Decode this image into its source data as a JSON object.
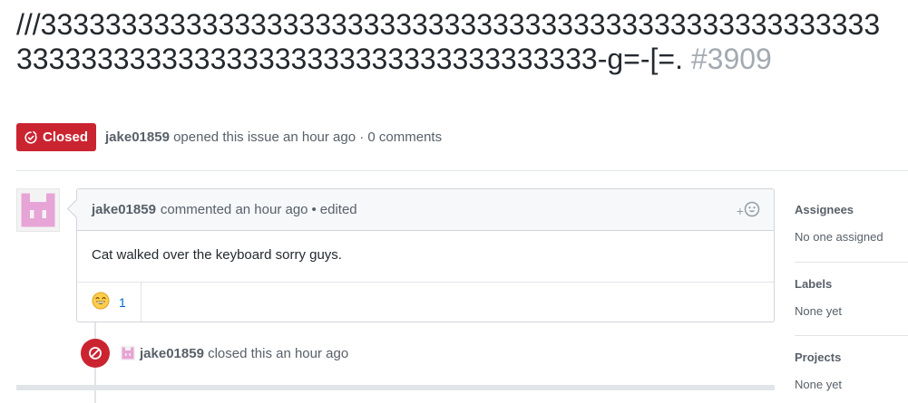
{
  "issue": {
    "title": "///3333333333333333333333333333333333333333333333333333333333333333333333333333333333333333-g=-[=.",
    "number": "#3909",
    "state_label": "Closed",
    "author": "jake01859",
    "meta_text": "opened this issue an hour ago · 0 comments"
  },
  "comment": {
    "author": "jake01859",
    "action": "commented an hour ago",
    "separator": "•",
    "edited": "edited",
    "reaction_picker": "+",
    "body": "Cat walked over the keyboard sorry guys.",
    "reaction_count": "1",
    "reaction_icon": "smile-emoji"
  },
  "event": {
    "author": "jake01859",
    "text": "closed this an hour ago",
    "icon": "circle-slash-icon"
  },
  "sidebar": {
    "sections": [
      {
        "heading": "Assignees",
        "value": "No one assigned"
      },
      {
        "heading": "Labels",
        "value": "None yet"
      },
      {
        "heading": "Projects",
        "value": "None yet"
      }
    ]
  },
  "colors": {
    "closed_red": "#cb2431",
    "avatar_pink": "#e7a4d6"
  }
}
